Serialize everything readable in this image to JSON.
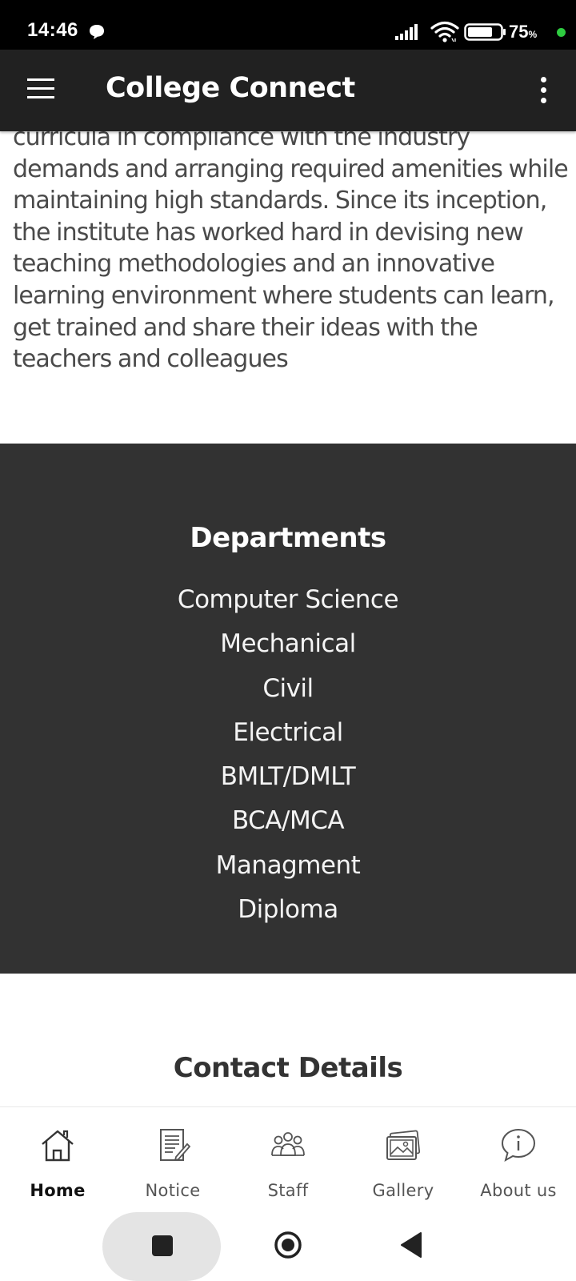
{
  "status_bar": {
    "time": "14:46",
    "battery_level": "75",
    "battery_unit": "%",
    "icons": [
      "chat-notification-icon",
      "signal-icon",
      "wifi-icon",
      "battery-icon"
    ],
    "charging_dot_color": "#2ecc40"
  },
  "app_bar": {
    "title": "College Connect",
    "background": "#212121",
    "icons": [
      "menu-icon",
      "overflow-menu-icon"
    ]
  },
  "about": {
    "text": "curricula in compliance with the industry demands and arranging required amenities while maintaining high standards. Since its inception, the institute has worked hard in devising new teaching methodologies and an innovative learning environment where students can learn, get trained and share their ideas with the teachers and colleagues"
  },
  "departments": {
    "title": "Departments",
    "background": "#323232",
    "items": [
      "Computer Science",
      "Mechanical",
      "Civil",
      "Electrical",
      "BMLT/DMLT",
      "BCA/MCA",
      "Managment",
      "Diploma"
    ]
  },
  "contact": {
    "title": "Contact Details"
  },
  "bottom_nav": {
    "items": [
      {
        "label": "Home",
        "icon": "home-icon",
        "active": true
      },
      {
        "label": "Notice",
        "icon": "notice-icon",
        "active": false
      },
      {
        "label": "Staff",
        "icon": "staff-icon",
        "active": false
      },
      {
        "label": "Gallery",
        "icon": "gallery-icon",
        "active": false
      },
      {
        "label": "About us",
        "icon": "info-icon",
        "active": false
      }
    ]
  },
  "system_nav": {
    "icons": [
      "recent-apps-icon",
      "home-circle-icon",
      "back-icon"
    ]
  }
}
